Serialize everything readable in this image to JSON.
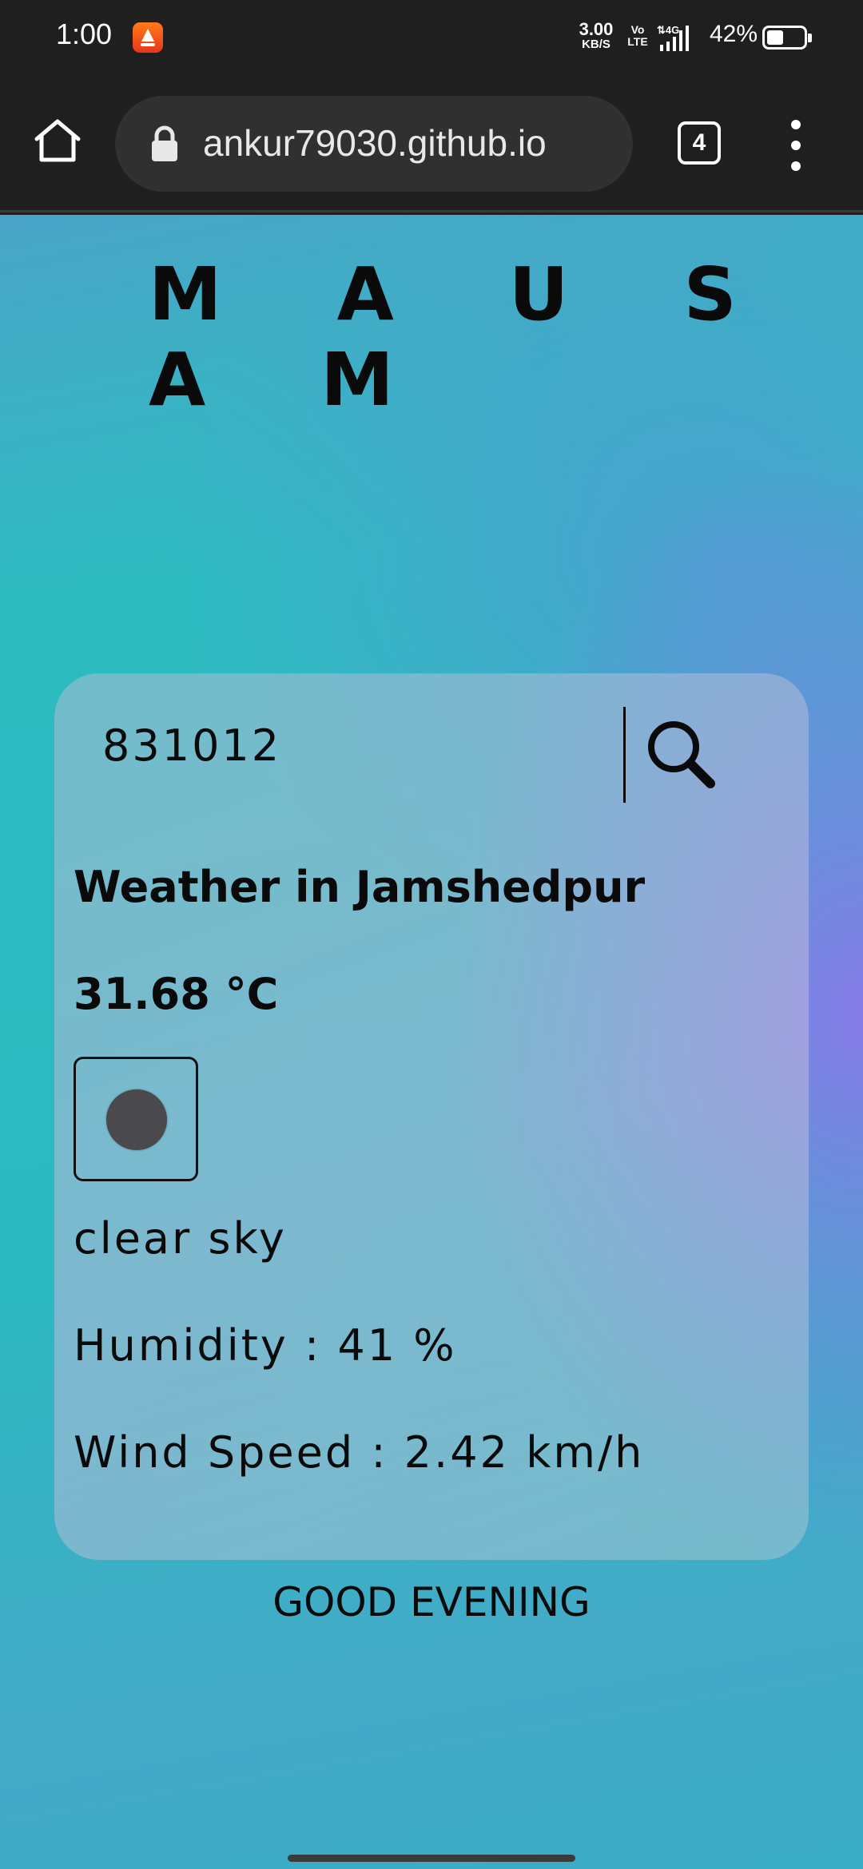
{
  "status_bar": {
    "time": "1:00",
    "speed_value": "3.00",
    "speed_unit": "KB/S",
    "volte_top": "Vo",
    "volte_bottom": "LTE",
    "battery_percent": "42%",
    "battery_level": 0.42
  },
  "browser": {
    "url": "ankur79030.github.io",
    "tab_count": "4",
    "icons": [
      "home-icon",
      "lock-icon",
      "tabs-icon",
      "more-vert-icon"
    ]
  },
  "app": {
    "title": "M A U S A M",
    "search": {
      "value": "831012",
      "icon": "search-icon"
    },
    "weather": {
      "heading": "Weather in Jamshedpur",
      "temperature": "31.68 °C",
      "icon": "weather-icon",
      "description": "clear sky",
      "humidity": "Humidity : 41 %",
      "wind_speed": "Wind Speed : 2.42 km/h"
    },
    "greeting": "GOOD EVENING"
  },
  "colors": {
    "status_bg": "#1f1f1f",
    "url_box": "#303030",
    "page_teal": "#2cbcc0",
    "page_violet": "#8c78eb",
    "text": "#0a0a0a"
  }
}
